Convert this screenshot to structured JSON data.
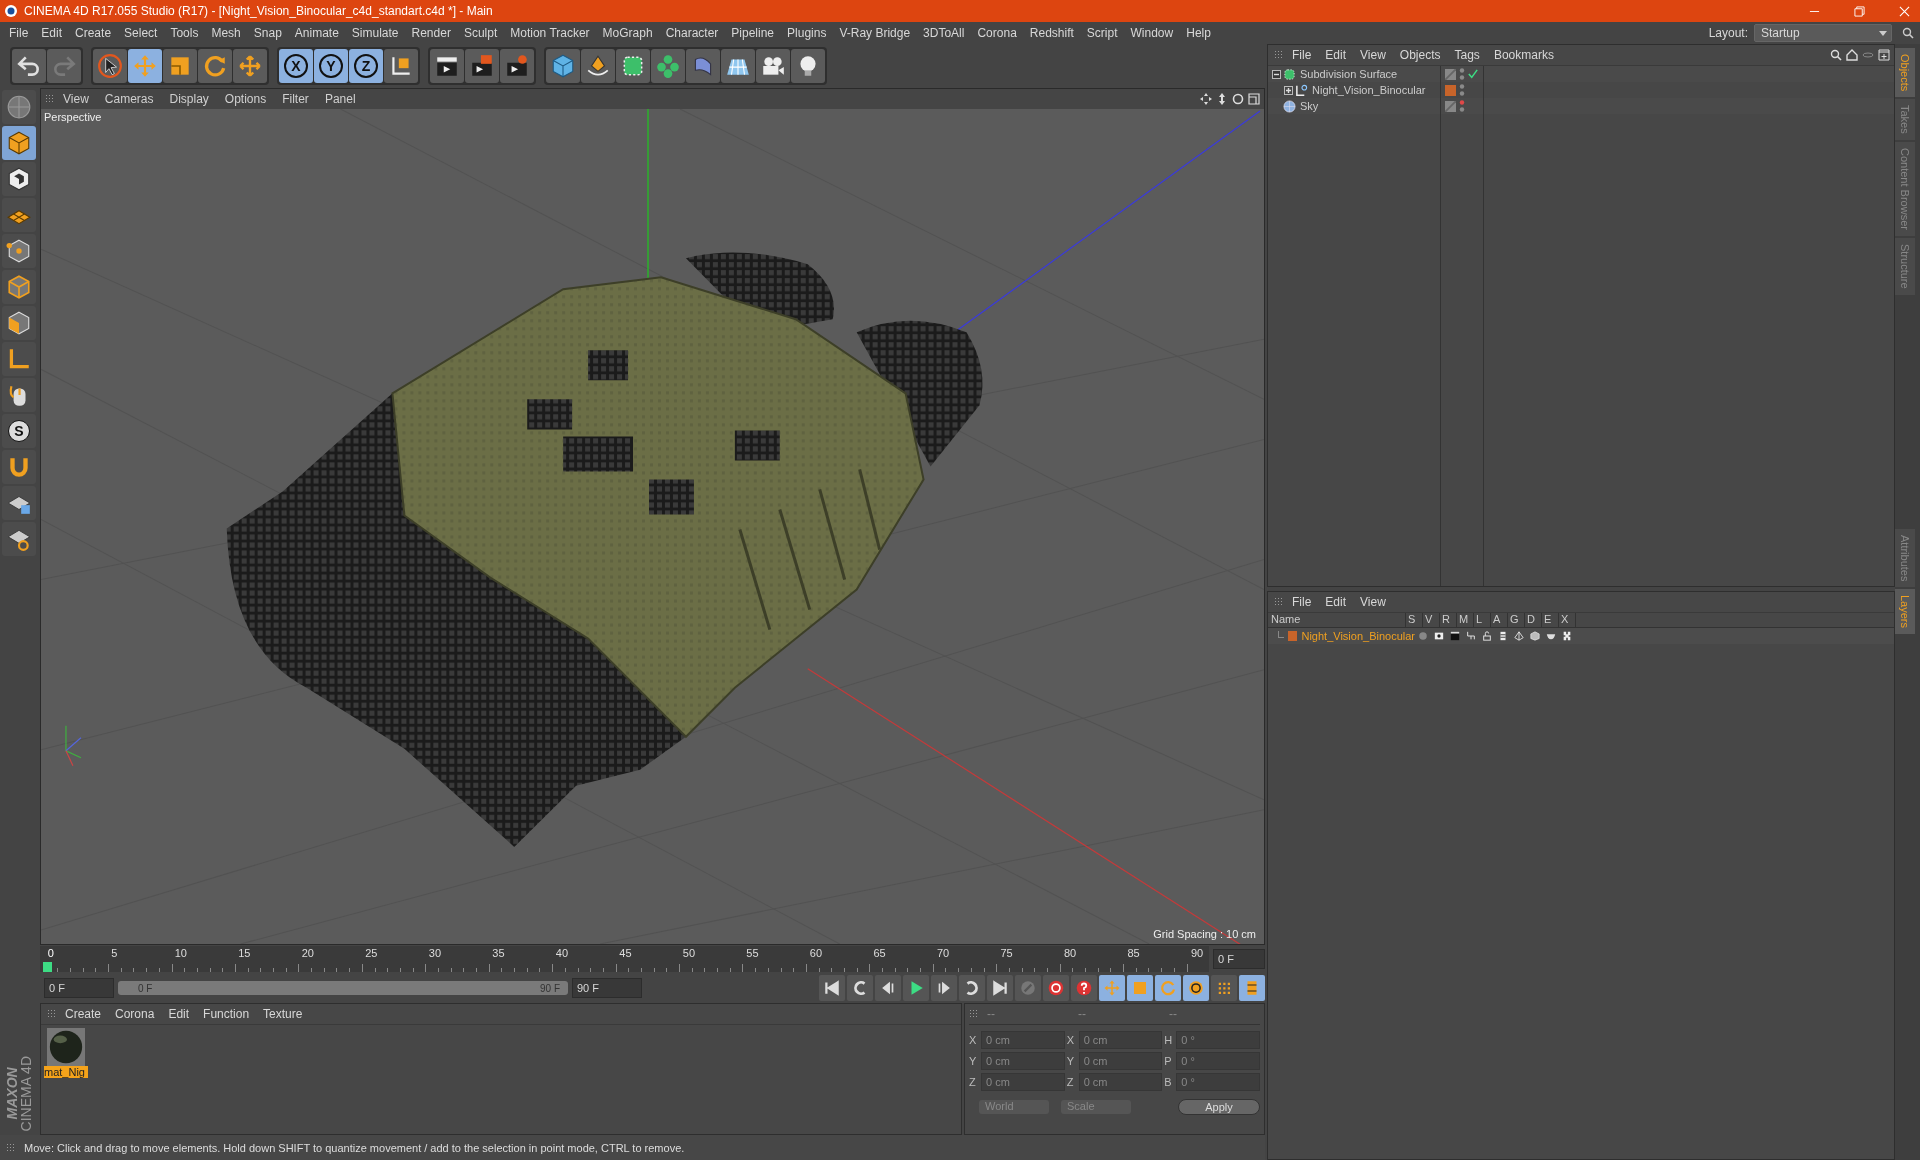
{
  "title_bar": {
    "title": "CINEMA 4D R17.055 Studio (R17) - [Night_Vision_Binocular_c4d_standart.c4d *] - Main"
  },
  "menu_bar": {
    "items": [
      "File",
      "Edit",
      "Create",
      "Select",
      "Tools",
      "Mesh",
      "Snap",
      "Animate",
      "Simulate",
      "Render",
      "Sculpt",
      "Motion Tracker",
      "MoGraph",
      "Character",
      "Pipeline",
      "Plugins",
      "V-Ray Bridge",
      "3DToAll",
      "Corona",
      "Redshift",
      "Script",
      "Window",
      "Help"
    ],
    "layout_label": "Layout:",
    "layout_value": "Startup"
  },
  "toolbar": [
    [
      {
        "kind": "undo",
        "selected": false
      },
      {
        "kind": "redo",
        "selected": false
      }
    ],
    [
      {
        "kind": "select",
        "selected": false
      },
      {
        "kind": "move",
        "selected": true
      },
      {
        "kind": "scale",
        "selected": false
      },
      {
        "kind": "rotate",
        "selected": false
      },
      {
        "kind": "transform",
        "selected": false
      }
    ],
    [
      {
        "kind": "axis",
        "label": "X",
        "selected": true
      },
      {
        "kind": "axis",
        "label": "Y",
        "selected": true
      },
      {
        "kind": "axis",
        "label": "Z",
        "selected": true
      },
      {
        "kind": "world",
        "selected": false
      }
    ],
    [
      {
        "kind": "render-view",
        "selected": false
      },
      {
        "kind": "render-picture",
        "selected": false
      },
      {
        "kind": "render-settings",
        "selected": false
      }
    ],
    [
      {
        "kind": "cube",
        "selected": false
      },
      {
        "kind": "pen",
        "selected": false
      },
      {
        "kind": "subdivision",
        "selected": false
      },
      {
        "kind": "cloner",
        "selected": false
      },
      {
        "kind": "bend",
        "selected": false
      },
      {
        "kind": "floor",
        "selected": false
      },
      {
        "kind": "camera",
        "selected": false
      },
      {
        "kind": "light",
        "selected": false
      }
    ]
  ],
  "left_toolbar": [
    {
      "kind": "model-mode",
      "selected": false
    },
    {
      "kind": "object-cube",
      "selected": true
    },
    {
      "kind": "texture-cube",
      "selected": false
    },
    {
      "kind": "workplane",
      "selected": false
    },
    {
      "kind": "points-cube",
      "selected": false
    },
    {
      "kind": "edges-cube",
      "selected": false
    },
    {
      "kind": "polygons-cube",
      "selected": false
    },
    {
      "kind": "axis-tool",
      "selected": false
    },
    {
      "kind": "tweak",
      "selected": false
    },
    {
      "kind": "snap",
      "label": "S",
      "selected": false
    },
    {
      "kind": "magnet",
      "selected": false
    },
    {
      "kind": "grid-lock",
      "selected": false
    },
    {
      "kind": "grid-snap",
      "selected": false
    }
  ],
  "viewport": {
    "menu": [
      "View",
      "Cameras",
      "Display",
      "Options",
      "Filter",
      "Panel"
    ],
    "camera_label": "Perspective",
    "grid_spacing": "Grid Spacing : 10 cm"
  },
  "timeline": {
    "ticks": [
      "0",
      "5",
      "10",
      "15",
      "20",
      "25",
      "30",
      "35",
      "40",
      "45",
      "50",
      "55",
      "60",
      "65",
      "70",
      "75",
      "80",
      "85",
      "90"
    ],
    "playhead": {
      "level": 0
    },
    "range": {
      "level": 1
    },
    "end_field": "0 F",
    "current_field": "0 F",
    "range_start": "0 F",
    "range_end": "90 F",
    "max_field": "90 F"
  },
  "material_manager": {
    "menu": [
      "Create",
      "Corona",
      "Edit",
      "Function",
      "Texture"
    ],
    "materials": [
      {
        "name": "mat_Nig",
        "selected": true
      }
    ]
  },
  "coordinates": {
    "headers": [
      "--",
      "--",
      "--"
    ],
    "rows": [
      {
        "pos_axis": "X",
        "position": "0 cm",
        "size_axis": "X",
        "size": "0 cm",
        "rot_axis": "H",
        "rotation": "0 °"
      },
      {
        "pos_axis": "Y",
        "position": "0 cm",
        "size_axis": "Y",
        "size": "0 cm",
        "rot_axis": "P",
        "rotation": "0 °"
      },
      {
        "pos_axis": "Z",
        "position": "0 cm",
        "size_axis": "Z",
        "size": "0 cm",
        "rot_axis": "B",
        "rotation": "0 °"
      }
    ],
    "mode": "World",
    "transform_mode": "Scale",
    "apply": "Apply"
  },
  "object_manager": {
    "menu": [
      "File",
      "Edit",
      "View",
      "Objects",
      "Tags",
      "Bookmarks"
    ],
    "objects": [
      {
        "name": "Subdivision Surface",
        "kind": "subdivision",
        "expanded": true,
        "checked": true,
        "children": [
          {
            "name": "Night_Vision_Binocular",
            "kind": "null",
            "expanded": false,
            "checked": false,
            "color": "#c8642a"
          }
        ]
      },
      {
        "name": "Sky",
        "kind": "sky",
        "checked": false
      }
    ]
  },
  "layer_manager": {
    "menu": [
      "File",
      "Edit",
      "View"
    ],
    "columns": [
      "Name",
      "S",
      "V",
      "R",
      "M",
      "L",
      "A",
      "G",
      "D",
      "E",
      "X"
    ],
    "layers": [
      {
        "name": "Night_Vision_Binocular",
        "color": "#c8642a"
      }
    ]
  },
  "side_tabs_top": [
    {
      "label": "Objects",
      "selected": true
    },
    {
      "label": "Takes",
      "selected": false
    },
    {
      "label": "Content Browser",
      "selected": false
    },
    {
      "label": "Structure",
      "selected": false
    }
  ],
  "side_tabs_bottom": [
    {
      "label": "Attributes",
      "selected": false
    },
    {
      "label": "Layers",
      "selected": true
    }
  ],
  "brand": {
    "company": "MAXON",
    "product": "CINEMA 4D"
  },
  "status_bar": {
    "text": "Move: Click and drag to move elements. Hold down SHIFT to quantize movement / add to the selection in point mode, CTRL to remove."
  }
}
